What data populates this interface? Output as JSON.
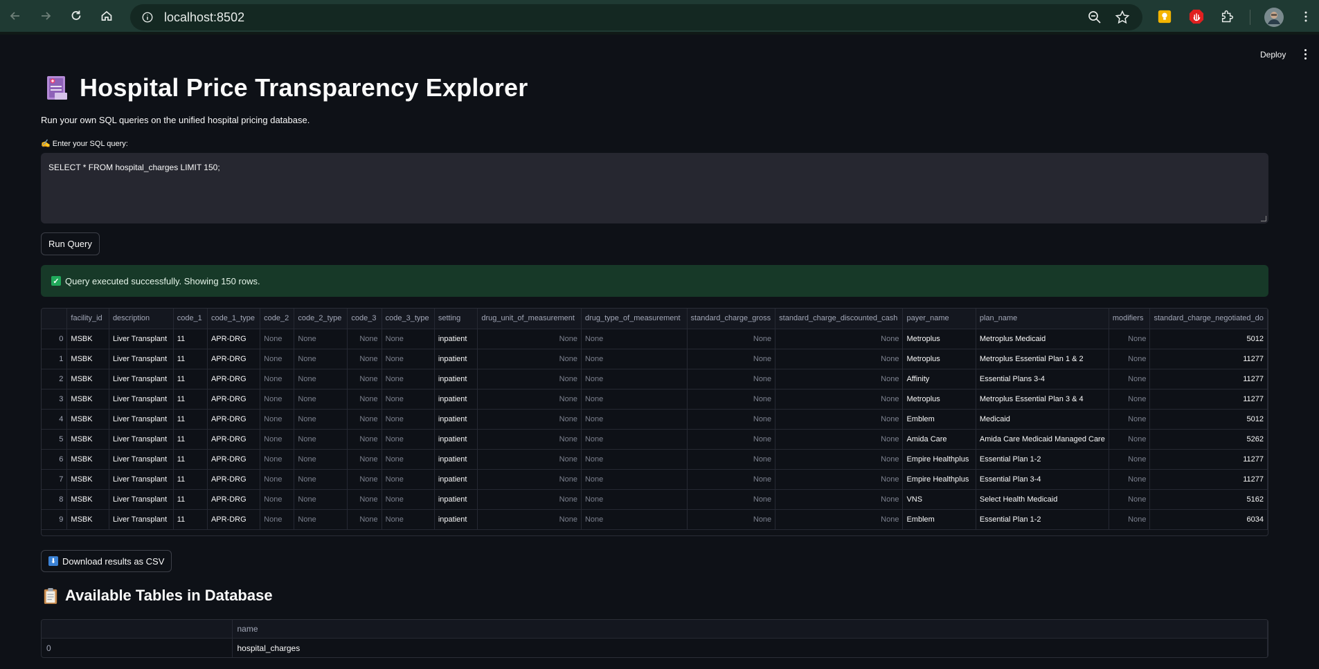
{
  "browser": {
    "url": "localhost:8502"
  },
  "header": {
    "deploy_label": "Deploy"
  },
  "page": {
    "title": "Hospital Price Transparency Explorer",
    "subtitle": "Run your own SQL queries on the unified hospital pricing database.",
    "query_label": "✍️ Enter your SQL query:",
    "query_value": "SELECT * FROM hospital_charges LIMIT 150;",
    "run_button": "Run Query",
    "success_message": "Query executed successfully. Showing 150 rows.",
    "download_button": "Download results as CSV",
    "tables_heading": "Available Tables in Database"
  },
  "results": {
    "columns": [
      "",
      "facility_id",
      "description",
      "code_1",
      "code_1_type",
      "code_2",
      "code_2_type",
      "code_3",
      "code_3_type",
      "setting",
      "drug_unit_of_measurement",
      "drug_type_of_measurement",
      "standard_charge_gross",
      "standard_charge_discounted_cash",
      "payer_name",
      "plan_name",
      "modifiers",
      "standard_charge_negotiated_do"
    ],
    "rows": [
      [
        "0",
        "MSBK",
        "Liver Transplant",
        "11",
        "APR-DRG",
        "None",
        "None",
        "None",
        "None",
        "inpatient",
        "None",
        "None",
        "None",
        "None",
        "Metroplus",
        "Metroplus Medicaid",
        "None",
        "5012"
      ],
      [
        "1",
        "MSBK",
        "Liver Transplant",
        "11",
        "APR-DRG",
        "None",
        "None",
        "None",
        "None",
        "inpatient",
        "None",
        "None",
        "None",
        "None",
        "Metroplus",
        "Metroplus Essential Plan 1 & 2",
        "None",
        "11277"
      ],
      [
        "2",
        "MSBK",
        "Liver Transplant",
        "11",
        "APR-DRG",
        "None",
        "None",
        "None",
        "None",
        "inpatient",
        "None",
        "None",
        "None",
        "None",
        "Affinity",
        "Essential Plans 3-4",
        "None",
        "11277"
      ],
      [
        "3",
        "MSBK",
        "Liver Transplant",
        "11",
        "APR-DRG",
        "None",
        "None",
        "None",
        "None",
        "inpatient",
        "None",
        "None",
        "None",
        "None",
        "Metroplus",
        "Metroplus Essential Plan 3 & 4",
        "None",
        "11277"
      ],
      [
        "4",
        "MSBK",
        "Liver Transplant",
        "11",
        "APR-DRG",
        "None",
        "None",
        "None",
        "None",
        "inpatient",
        "None",
        "None",
        "None",
        "None",
        "Emblem",
        "Medicaid",
        "None",
        "5012"
      ],
      [
        "5",
        "MSBK",
        "Liver Transplant",
        "11",
        "APR-DRG",
        "None",
        "None",
        "None",
        "None",
        "inpatient",
        "None",
        "None",
        "None",
        "None",
        "Amida Care",
        "Amida Care Medicaid Managed Care",
        "None",
        "5262"
      ],
      [
        "6",
        "MSBK",
        "Liver Transplant",
        "11",
        "APR-DRG",
        "None",
        "None",
        "None",
        "None",
        "inpatient",
        "None",
        "None",
        "None",
        "None",
        "Empire Healthplus",
        "Essential Plan 1-2",
        "None",
        "11277"
      ],
      [
        "7",
        "MSBK",
        "Liver Transplant",
        "11",
        "APR-DRG",
        "None",
        "None",
        "None",
        "None",
        "inpatient",
        "None",
        "None",
        "None",
        "None",
        "Empire Healthplus",
        "Essential Plan 3-4",
        "None",
        "11277"
      ],
      [
        "8",
        "MSBK",
        "Liver Transplant",
        "11",
        "APR-DRG",
        "None",
        "None",
        "None",
        "None",
        "inpatient",
        "None",
        "None",
        "None",
        "None",
        "VNS",
        "Select Health Medicaid",
        "None",
        "5162"
      ],
      [
        "9",
        "MSBK",
        "Liver Transplant",
        "11",
        "APR-DRG",
        "None",
        "None",
        "None",
        "None",
        "inpatient",
        "None",
        "None",
        "None",
        "None",
        "Emblem",
        "Essential Plan 1-2",
        "None",
        "6034"
      ]
    ]
  },
  "tables_list": {
    "columns": [
      "",
      "name"
    ],
    "rows": [
      [
        "0",
        "hospital_charges"
      ]
    ]
  }
}
